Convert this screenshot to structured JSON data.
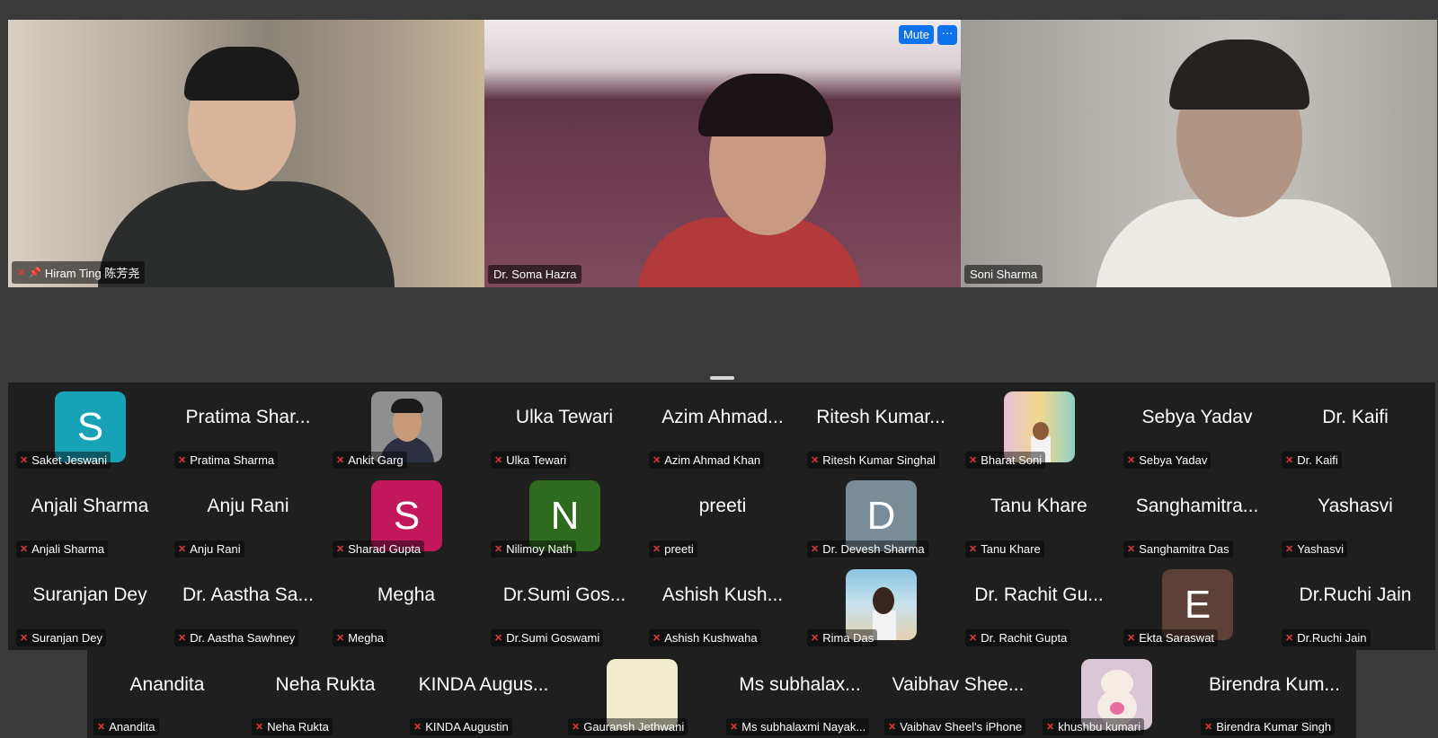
{
  "videos": [
    {
      "name": "Hiram Ting 陈芳尧",
      "pinned": true
    },
    {
      "name": "Dr. Soma Hazra",
      "pinned": false
    },
    {
      "name": "Soni Sharma",
      "pinned": false
    }
  ],
  "video_controls": {
    "mute_label": "Mute",
    "more_label": "···"
  },
  "icons": {
    "mic_muted": "mic-muted-icon",
    "pin": "pin-icon"
  },
  "colors": {
    "accent": "#0e72ed",
    "muted_red": "#e03a3a"
  },
  "participants": [
    {
      "display": "",
      "label": "Saket Jeswani",
      "avatar": "S",
      "avatar_color": "#17a2b8"
    },
    {
      "display": "Pratima Shar...",
      "label": "Pratima Sharma"
    },
    {
      "display": "",
      "label": "Ankit Garg",
      "photo": "man-suit"
    },
    {
      "display": "Ulka Tewari",
      "label": "Ulka Tewari"
    },
    {
      "display": "Azim Ahmad...",
      "label": "Azim Ahmad Khan"
    },
    {
      "display": "Ritesh Kumar...",
      "label": "Ritesh Kumar Singhal"
    },
    {
      "display": "",
      "label": "Bharat Soni",
      "photo": "man-colorful"
    },
    {
      "display": "Sebya Yadav",
      "label": "Sebya Yadav"
    },
    {
      "display": "Dr. Kaifi",
      "label": "Dr. Kaifi"
    },
    {
      "display": "Anjali Sharma",
      "label": "Anjali Sharma"
    },
    {
      "display": "Anju Rani",
      "label": "Anju Rani"
    },
    {
      "display": "",
      "label": "Sharad Gupta",
      "avatar": "S",
      "avatar_color": "#c2185b"
    },
    {
      "display": "",
      "label": "Nilimoy Nath",
      "avatar": "N",
      "avatar_color": "#2e6b1f"
    },
    {
      "display": "preeti",
      "label": "preeti"
    },
    {
      "display": "",
      "label": "Dr. Devesh Sharma",
      "avatar": "D",
      "avatar_color": "#7b8c99"
    },
    {
      "display": "Tanu Khare",
      "label": "Tanu Khare"
    },
    {
      "display": "Sanghamitra...",
      "label": "Sanghamitra Das"
    },
    {
      "display": "Yashasvi",
      "label": "Yashasvi"
    },
    {
      "display": "Suranjan Dey",
      "label": "Suranjan Dey"
    },
    {
      "display": "Dr. Aastha Sa...",
      "label": "Dr. Aastha Sawhney"
    },
    {
      "display": "Megha",
      "label": "Megha"
    },
    {
      "display": "Dr.Sumi Gos...",
      "label": "Dr.Sumi Goswami"
    },
    {
      "display": "Ashish Kush...",
      "label": "Ashish Kushwaha"
    },
    {
      "display": "",
      "label": "Rima Das",
      "photo": "woman-beach"
    },
    {
      "display": "Dr. Rachit Gu...",
      "label": "Dr. Rachit Gupta"
    },
    {
      "display": "",
      "label": "Ekta Saraswat",
      "avatar": "E",
      "avatar_color": "#5d4037"
    },
    {
      "display": "Dr.Ruchi Jain",
      "label": "Dr.Ruchi Jain"
    }
  ],
  "participants_last_row": [
    {
      "display": "Anandita",
      "label": "Anandita"
    },
    {
      "display": "Neha Rukta",
      "label": "Neha Rukta"
    },
    {
      "display": "KINDA Augus...",
      "label": "KINDA Augustin"
    },
    {
      "display": "",
      "label": "Gauransh Jethwani",
      "photo": "blank-cream"
    },
    {
      "display": "Ms subhalax...",
      "label": "Ms subhalaxmi Nayak..."
    },
    {
      "display": "Vaibhav Shee...",
      "label": "Vaibhav Sheel's iPhone"
    },
    {
      "display": "",
      "label": "khushbu kumari",
      "photo": "teddy-bear"
    },
    {
      "display": "Birendra Kum...",
      "label": "Birendra Kumar Singh"
    }
  ]
}
